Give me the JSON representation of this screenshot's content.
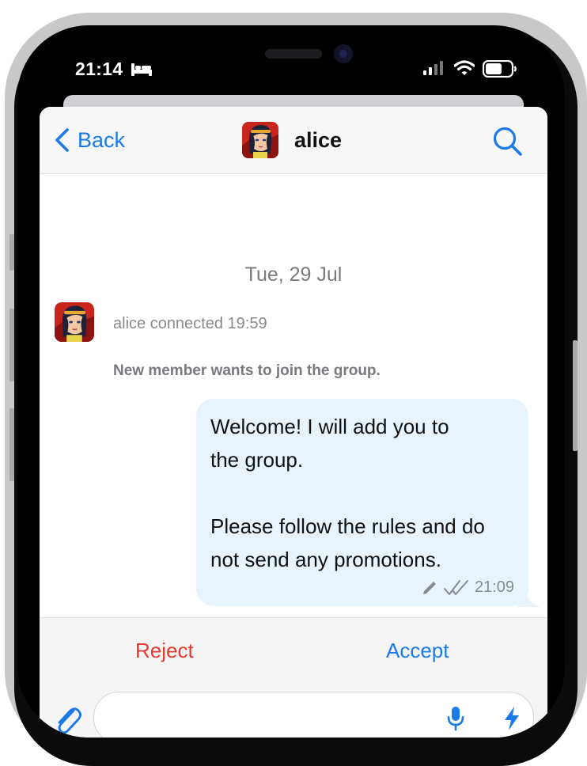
{
  "status_bar": {
    "time": "21:14",
    "icons": [
      "bed-icon",
      "signal-icon",
      "wifi-icon",
      "battery-icon"
    ]
  },
  "navbar": {
    "back_label": "Back",
    "contact_name": "alice",
    "icons": [
      "chevron-left-icon",
      "search-icon"
    ]
  },
  "chat": {
    "date_separator": "Tue, 29 Jul",
    "event_text": "alice connected 19:59",
    "group_note": "New member wants to join the group.",
    "message": {
      "lines": [
        "Welcome! I will add you to",
        "the group.",
        "",
        "Please follow the rules and do",
        "not send any promotions."
      ],
      "time": "21:09",
      "status_icons": [
        "edited-pencil-icon",
        "double-check-icon"
      ]
    }
  },
  "actions": {
    "reject_label": "Reject",
    "accept_label": "Accept"
  },
  "composer": {
    "placeholder": "",
    "icons": [
      "paperclip-icon",
      "microphone-icon",
      "lightning-icon"
    ]
  },
  "colors": {
    "accent_blue": "#1a7ae8",
    "reject_red": "#e43b2f",
    "bubble_bg": "#e8f4fd"
  }
}
